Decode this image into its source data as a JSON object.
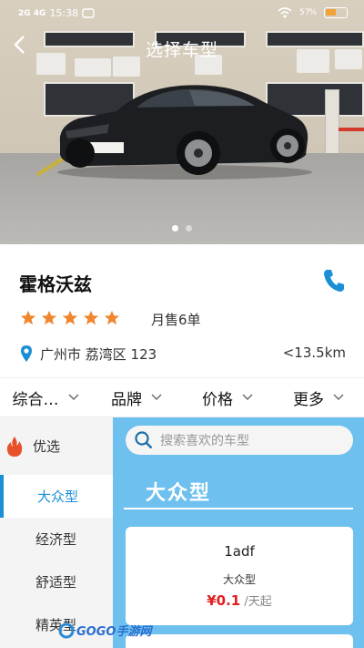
{
  "status_bar": {
    "signal": "2G 4G",
    "time": "15:38",
    "battery": "57",
    "battery_level": 0.57
  },
  "nav": {
    "title": "选择车型",
    "back_icon": "chevron-left-icon"
  },
  "hero": {
    "slide_count": 2,
    "active_slide": 1
  },
  "shop": {
    "name": "霍格沃兹",
    "rating": 5,
    "rating_max": 5,
    "monthly_sales": "月售6单",
    "address": "广州市 荔湾区 123",
    "distance": "<13.5km",
    "accent": "#1a8fd6",
    "star_color": "#f0862f"
  },
  "filters": [
    {
      "label": "综合…"
    },
    {
      "label": "品牌"
    },
    {
      "label": "价格"
    },
    {
      "label": "更多"
    }
  ],
  "sidebar": {
    "items": [
      {
        "label": "优选",
        "icon": "fire-icon"
      },
      {
        "label": "大众型",
        "active": true
      },
      {
        "label": "经济型"
      },
      {
        "label": "舒适型"
      },
      {
        "label": "精英型"
      }
    ]
  },
  "main": {
    "search_placeholder": "搜索喜欢的车型",
    "category_title": "大众型",
    "background": "#6ec0ee",
    "cars": [
      {
        "name": "1adf",
        "type": "大众型",
        "price": "¥0.1",
        "unit": "/天起"
      }
    ]
  },
  "watermark": {
    "text": "GOGO手游网"
  }
}
